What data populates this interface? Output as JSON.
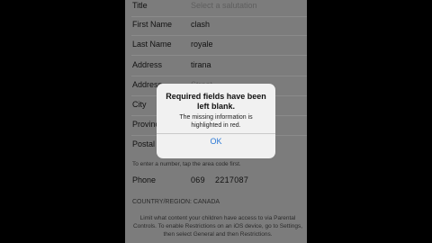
{
  "form": {
    "rows": [
      {
        "label": "Title",
        "value": "Select a salutation",
        "style": "placeholder"
      },
      {
        "label": "First Name",
        "value": "clash",
        "style": "value"
      },
      {
        "label": "Last Name",
        "value": "royale",
        "style": "value"
      },
      {
        "label": "Address",
        "value": "tirana",
        "style": "value"
      },
      {
        "label": "Address",
        "value": "Street",
        "style": "placeholder"
      },
      {
        "label": "City",
        "value": "",
        "style": "value"
      },
      {
        "label": "Province",
        "value": "",
        "style": "value"
      },
      {
        "label": "Postal Code",
        "value": "",
        "style": "value"
      }
    ],
    "phone_hint": "To enter a number, tap the area code first.",
    "phone": {
      "label": "Phone",
      "area_code": "069",
      "number": "2217087"
    },
    "country": "COUNTRY/REGION: CANADA",
    "footer": "Limit what content your children have access to via Parental Controls. To enable Restrictions on an iOS device, go to Settings, then select General and then Restrictions."
  },
  "alert": {
    "title": "Required fields have been left blank.",
    "message": "The missing information is highlighted in red.",
    "ok_label": "OK"
  },
  "colors": {
    "background": "#000000",
    "dimmed_screen": "#7c7c7c",
    "alert_background": "#f1f1f1",
    "ok_button": "#2a78d6"
  }
}
